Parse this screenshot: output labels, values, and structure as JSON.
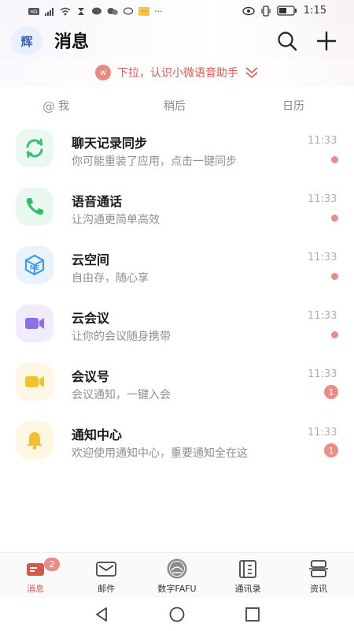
{
  "status_bar": {
    "time": "1:15",
    "battery": ""
  },
  "header": {
    "avatar_text": "辉",
    "title": "消息"
  },
  "banner": {
    "badge": "w",
    "text": "下拉，认识小微语音助手"
  },
  "subtabs": [
    "我",
    "稍后",
    "日历"
  ],
  "messages": [
    {
      "title": "聊天记录同步",
      "subtitle": "你可能重装了应用，点击一键同步",
      "time": "11:33",
      "icon": "sync-icon",
      "icon_color": "#3bbf74",
      "icon_bg": "#eaf8f0",
      "unread": "dot"
    },
    {
      "title": "语音通话",
      "subtitle": "让沟通更简单高效",
      "time": "11:33",
      "icon": "phone-icon",
      "icon_color": "#2fbf66",
      "icon_bg": "#e9f8ef",
      "unread": "dot"
    },
    {
      "title": "云空间",
      "subtitle": "自由存，随心享",
      "time": "11:33",
      "icon": "cloud-space-icon",
      "icon_color": "#3aa0e8",
      "icon_bg": "#eaf3fb",
      "unread": "dot"
    },
    {
      "title": "云会议",
      "subtitle": "让你的会议随身携带",
      "time": "11:33",
      "icon": "video-icon",
      "icon_color": "#8c6ee6",
      "icon_bg": "#f0ecfb",
      "unread": "dot"
    },
    {
      "title": "会议号",
      "subtitle": "会议通知，一键入会",
      "time": "11:33",
      "icon": "video-icon",
      "icon_color": "#f2c12e",
      "icon_bg": "#fdf7e4",
      "unread": "1"
    },
    {
      "title": "通知中心",
      "subtitle": "欢迎使用通知中心，重要通知全在这",
      "time": "11:33",
      "icon": "bell-icon",
      "icon_color": "#f2c12e",
      "icon_bg": "#fdf7e4",
      "unread": "1"
    }
  ],
  "tabbar": {
    "tabs": [
      {
        "label": "消息",
        "icon": "message-icon",
        "badge": "2",
        "active": true
      },
      {
        "label": "邮件",
        "icon": "mail-icon"
      },
      {
        "label": "数字FAFU",
        "icon": "campus-logo-icon"
      },
      {
        "label": "通讯录",
        "icon": "contacts-icon"
      },
      {
        "label": "资讯",
        "icon": "news-icon"
      }
    ]
  },
  "colors": {
    "accent": "#d9584c",
    "badge": "#ea8d87"
  }
}
